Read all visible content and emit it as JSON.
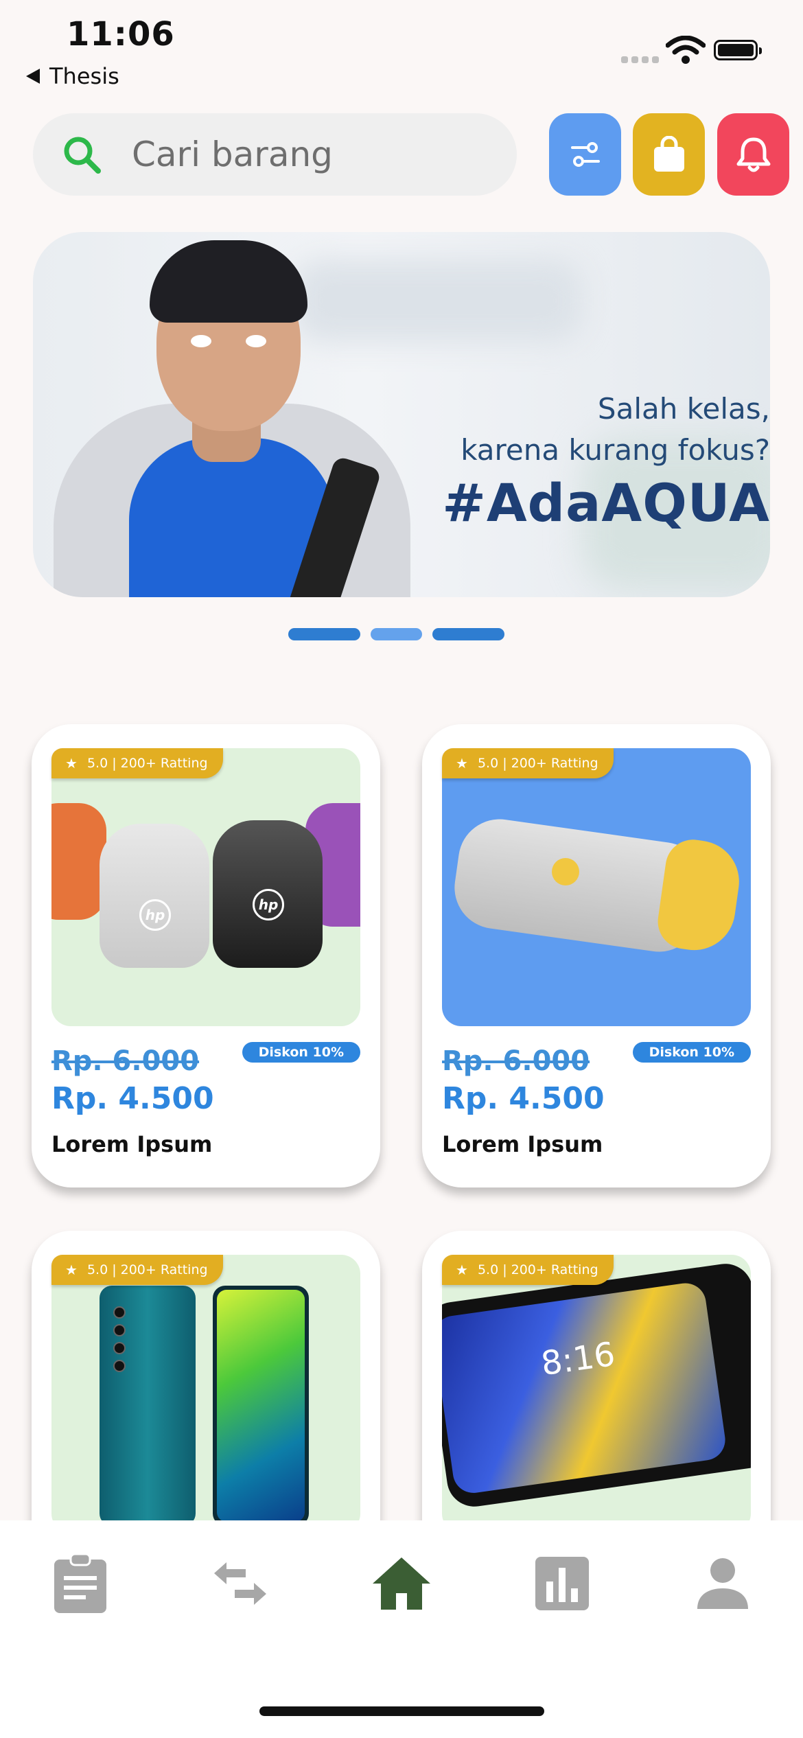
{
  "status_bar": {
    "time": "11:06",
    "back_label": "Thesis"
  },
  "search": {
    "placeholder": "Cari barang"
  },
  "banner": {
    "line1": "Salah kelas,",
    "line2": "karena kurang fokus?",
    "hashtag": "#AdaAQUA"
  },
  "carousel": {
    "count": 3,
    "active_index": 1
  },
  "products": [
    {
      "rating": "5.0 | 200+ Ratting",
      "discount": "Diskon 10%",
      "old_price": "Rp. 6.000",
      "price": "Rp. 4.500",
      "name": "Lorem Ipsum",
      "image": "hp-portable-speakers"
    },
    {
      "rating": "5.0 | 200+ Ratting",
      "discount": "Diskon 10%",
      "old_price": "Rp. 6.000",
      "price": "Rp. 4.500",
      "name": "Lorem Ipsum",
      "image": "hp-bar-speaker"
    },
    {
      "rating": "5.0 | 200+ Ratting",
      "image": "xiaomi-mi-note-phones"
    },
    {
      "rating": "5.0 | 200+ Ratting",
      "image": "xiaomi-mi-mix-slider-phone"
    }
  ],
  "nav": [
    {
      "icon": "clipboard-icon"
    },
    {
      "icon": "swap-arrows-icon"
    },
    {
      "icon": "home-icon",
      "active": true
    },
    {
      "icon": "bar-chart-icon"
    },
    {
      "icon": "person-icon"
    }
  ],
  "colors": {
    "filter_btn": "#5E9CF0",
    "bag_btn": "#E2B321",
    "bell_btn": "#F2465C",
    "price": "#2E86DE",
    "rating_badge": "#E2AE22",
    "nav_active": "#3B5E34",
    "nav_inactive": "#A7A7A7"
  }
}
